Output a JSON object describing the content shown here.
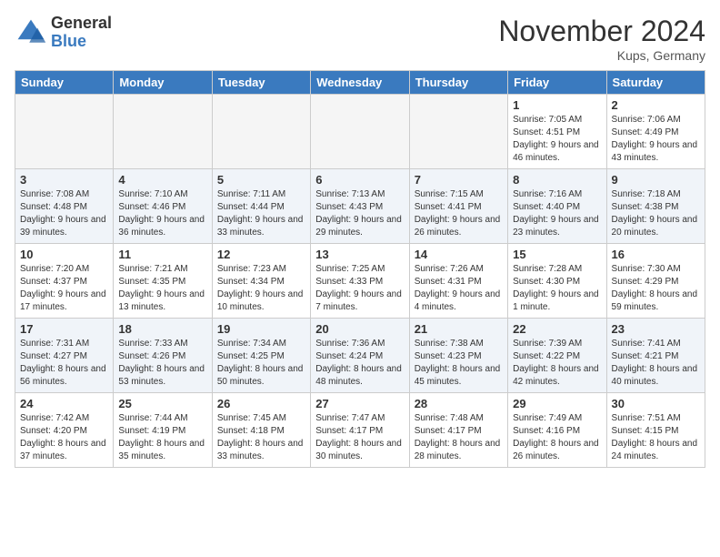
{
  "logo": {
    "general": "General",
    "blue": "Blue"
  },
  "title": "November 2024",
  "location": "Kups, Germany",
  "days_of_week": [
    "Sunday",
    "Monday",
    "Tuesday",
    "Wednesday",
    "Thursday",
    "Friday",
    "Saturday"
  ],
  "weeks": [
    [
      {
        "day": "",
        "info": ""
      },
      {
        "day": "",
        "info": ""
      },
      {
        "day": "",
        "info": ""
      },
      {
        "day": "",
        "info": ""
      },
      {
        "day": "",
        "info": ""
      },
      {
        "day": "1",
        "info": "Sunrise: 7:05 AM\nSunset: 4:51 PM\nDaylight: 9 hours and 46 minutes."
      },
      {
        "day": "2",
        "info": "Sunrise: 7:06 AM\nSunset: 4:49 PM\nDaylight: 9 hours and 43 minutes."
      }
    ],
    [
      {
        "day": "3",
        "info": "Sunrise: 7:08 AM\nSunset: 4:48 PM\nDaylight: 9 hours and 39 minutes."
      },
      {
        "day": "4",
        "info": "Sunrise: 7:10 AM\nSunset: 4:46 PM\nDaylight: 9 hours and 36 minutes."
      },
      {
        "day": "5",
        "info": "Sunrise: 7:11 AM\nSunset: 4:44 PM\nDaylight: 9 hours and 33 minutes."
      },
      {
        "day": "6",
        "info": "Sunrise: 7:13 AM\nSunset: 4:43 PM\nDaylight: 9 hours and 29 minutes."
      },
      {
        "day": "7",
        "info": "Sunrise: 7:15 AM\nSunset: 4:41 PM\nDaylight: 9 hours and 26 minutes."
      },
      {
        "day": "8",
        "info": "Sunrise: 7:16 AM\nSunset: 4:40 PM\nDaylight: 9 hours and 23 minutes."
      },
      {
        "day": "9",
        "info": "Sunrise: 7:18 AM\nSunset: 4:38 PM\nDaylight: 9 hours and 20 minutes."
      }
    ],
    [
      {
        "day": "10",
        "info": "Sunrise: 7:20 AM\nSunset: 4:37 PM\nDaylight: 9 hours and 17 minutes."
      },
      {
        "day": "11",
        "info": "Sunrise: 7:21 AM\nSunset: 4:35 PM\nDaylight: 9 hours and 13 minutes."
      },
      {
        "day": "12",
        "info": "Sunrise: 7:23 AM\nSunset: 4:34 PM\nDaylight: 9 hours and 10 minutes."
      },
      {
        "day": "13",
        "info": "Sunrise: 7:25 AM\nSunset: 4:33 PM\nDaylight: 9 hours and 7 minutes."
      },
      {
        "day": "14",
        "info": "Sunrise: 7:26 AM\nSunset: 4:31 PM\nDaylight: 9 hours and 4 minutes."
      },
      {
        "day": "15",
        "info": "Sunrise: 7:28 AM\nSunset: 4:30 PM\nDaylight: 9 hours and 1 minute."
      },
      {
        "day": "16",
        "info": "Sunrise: 7:30 AM\nSunset: 4:29 PM\nDaylight: 8 hours and 59 minutes."
      }
    ],
    [
      {
        "day": "17",
        "info": "Sunrise: 7:31 AM\nSunset: 4:27 PM\nDaylight: 8 hours and 56 minutes."
      },
      {
        "day": "18",
        "info": "Sunrise: 7:33 AM\nSunset: 4:26 PM\nDaylight: 8 hours and 53 minutes."
      },
      {
        "day": "19",
        "info": "Sunrise: 7:34 AM\nSunset: 4:25 PM\nDaylight: 8 hours and 50 minutes."
      },
      {
        "day": "20",
        "info": "Sunrise: 7:36 AM\nSunset: 4:24 PM\nDaylight: 8 hours and 48 minutes."
      },
      {
        "day": "21",
        "info": "Sunrise: 7:38 AM\nSunset: 4:23 PM\nDaylight: 8 hours and 45 minutes."
      },
      {
        "day": "22",
        "info": "Sunrise: 7:39 AM\nSunset: 4:22 PM\nDaylight: 8 hours and 42 minutes."
      },
      {
        "day": "23",
        "info": "Sunrise: 7:41 AM\nSunset: 4:21 PM\nDaylight: 8 hours and 40 minutes."
      }
    ],
    [
      {
        "day": "24",
        "info": "Sunrise: 7:42 AM\nSunset: 4:20 PM\nDaylight: 8 hours and 37 minutes."
      },
      {
        "day": "25",
        "info": "Sunrise: 7:44 AM\nSunset: 4:19 PM\nDaylight: 8 hours and 35 minutes."
      },
      {
        "day": "26",
        "info": "Sunrise: 7:45 AM\nSunset: 4:18 PM\nDaylight: 8 hours and 33 minutes."
      },
      {
        "day": "27",
        "info": "Sunrise: 7:47 AM\nSunset: 4:17 PM\nDaylight: 8 hours and 30 minutes."
      },
      {
        "day": "28",
        "info": "Sunrise: 7:48 AM\nSunset: 4:17 PM\nDaylight: 8 hours and 28 minutes."
      },
      {
        "day": "29",
        "info": "Sunrise: 7:49 AM\nSunset: 4:16 PM\nDaylight: 8 hours and 26 minutes."
      },
      {
        "day": "30",
        "info": "Sunrise: 7:51 AM\nSunset: 4:15 PM\nDaylight: 8 hours and 24 minutes."
      }
    ]
  ]
}
